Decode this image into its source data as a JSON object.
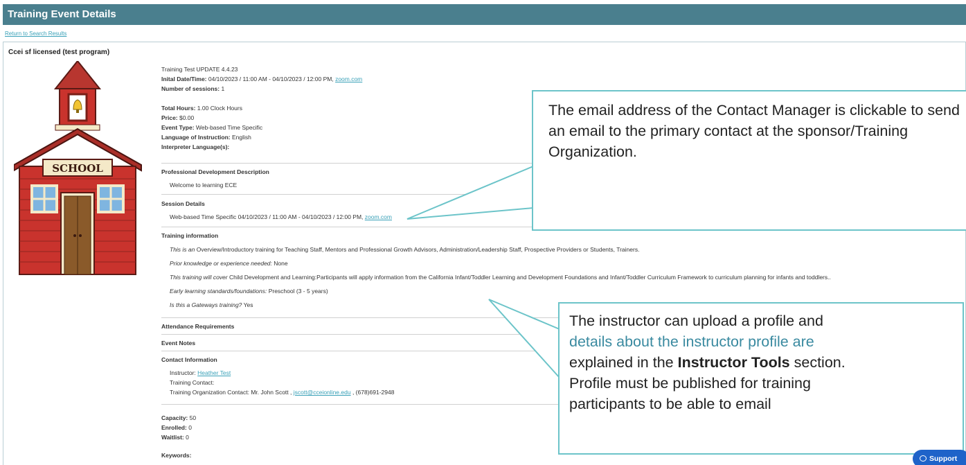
{
  "header": {
    "title": "Training Event Details"
  },
  "return_link": "Return to Search Results",
  "panel_title": "Ccei sf licensed (test program)",
  "school_sign": "SCHOOL",
  "event": {
    "name": "Training Test UPDATE 4.4.23",
    "initial_label": "Inital Date/Time:",
    "initial_value": " 04/10/2023 / 11:00 AM - 04/10/2023 / 12:00 PM, ",
    "initial_link": "zoom.com",
    "sessions_label": "Number of sessions:",
    "sessions_value": " 1",
    "hours_label": "Total Hours:",
    "hours_value": " 1.00 Clock Hours",
    "price_label": "Price:",
    "price_value": " $0.00",
    "type_label": "Event Type:",
    "type_value": " Web-based Time Specific",
    "language_label": "Language of Instruction:",
    "language_value": " English",
    "interpreter_label": "Interpreter Language(s):"
  },
  "pd": {
    "heading": "Professional Development Description",
    "text": "Welcome to learning ECE"
  },
  "session": {
    "heading": "Session Details",
    "text": "Web-based Time Specific 04/10/2023 / 11:00 AM - 04/10/2023 / 12:00 PM, ",
    "link": "zoom.com"
  },
  "training_info": {
    "heading": "Training information",
    "l1_it": "This is an",
    "l1_text": " Overview/Introductory training for Teaching Staff, Mentors and Professional Growth Advisors, Administration/Leadership Staff, Prospective Providers or Students, Trainers.",
    "l2_it": "Prior knowledge or experience needed:",
    "l2_text": " None",
    "l3_it": "This training will cover",
    "l3_text": " Child Development and Learning:Participants will apply information from the California Infant/Toddler Learning and Development Foundations and Infant/Toddler Curriculum Framework to curriculum planning for infants and toddlers..",
    "l4_it": "Early learning standards/foundations:",
    "l4_text": " Preschool (3 - 5 years)",
    "l5_it": "Is this a Gateways training?",
    "l5_text": " Yes"
  },
  "attendance": {
    "heading": "Attendance Requirements"
  },
  "notes": {
    "heading": "Event Notes"
  },
  "contact": {
    "heading": "Contact Information",
    "instructor_label": "Instructor: ",
    "instructor_link": "Heather Test",
    "training_contact": "Training Contact:",
    "org_label": "Training Organization Contact: Mr. John Scott , ",
    "org_email": "jscott@cceionline.edu",
    "org_phone": " , (678)691-2948"
  },
  "stats": {
    "capacity_label": "Capacity:",
    "capacity_value": " 50",
    "enrolled_label": "Enrolled:",
    "enrolled_value": " 0",
    "waitlist_label": "Waitlist:",
    "waitlist_value": " 0",
    "keywords_label": "Keywords:"
  },
  "callout1": {
    "text": "The email address of the Contact Manager is clickable to send an email to the primary contact at the sponsor/Training Organization."
  },
  "callout2": {
    "t1": "The instructor can upload a profile and",
    "t2": "details about the instructor profile are",
    "t3a": "explained in the ",
    "t3b": "Instructor Tools",
    "t3c": " section.",
    "t4": "Profile must be published for training",
    "t5": "participants to be able to email"
  },
  "support": {
    "label": "Support",
    "icon": "chat-bubble-icon"
  },
  "colors": {
    "header": "#4a7f8e",
    "link": "#3aa1b8",
    "callout_border": "#6cc4c9",
    "support": "#1e63c9"
  }
}
